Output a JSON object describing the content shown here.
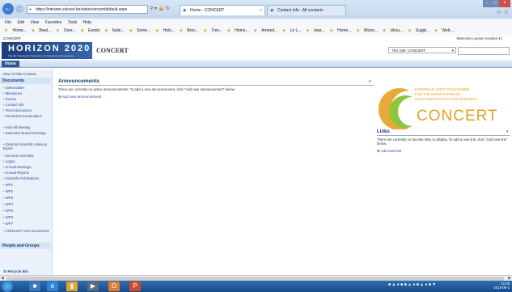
{
  "browser": {
    "address_url": "https://intranet.sckcen.be/sites/concert/default.aspx",
    "tabs": [
      {
        "label": "Home - CONCERT"
      },
      {
        "label": "Contact info - All contacts"
      }
    ],
    "menu": [
      "File",
      "Edit",
      "View",
      "Favorites",
      "Tools",
      "Help"
    ],
    "favorites": [
      "Home...",
      "Bowl...",
      "Over...",
      "Eendo",
      "Italie...",
      "Some...",
      "Hoki...",
      "Broc...",
      "Trev...",
      "Home...",
      "Ameed...",
      "Le L...",
      "step...",
      "Home...",
      "Wooo...",
      "zikou...",
      "Suggt...",
      "Web ..."
    ]
  },
  "sharepoint": {
    "breadcrumb": "CONCERT",
    "welcome": "Welcome Leysen Kristina ▾ |",
    "logo_text": "HORIZON 2020",
    "logo_sub": "The EU Framework Programme for Research and Innovation",
    "site_title": "CONCERT",
    "search_scope": "This Site: CONCERT",
    "home_tab": "Home",
    "view_all": "View All Site Content",
    "documents_heading": "Documents",
    "nav_items": [
      "Deliverables",
      "Milestones",
      "Events",
      "Contact info",
      "Team Discussion",
      "General Documentation",
      "Kick-off Meeting",
      "Executive Board Meetings",
      "External Scientific Advisory Board",
      "General Assembly",
      "Logos",
      "Annual Meetings",
      "Annual Reports",
      "Scientific Publications",
      "WP1",
      "WP2",
      "WP3",
      "WP4",
      "WP5",
      "WP6",
      "WP7",
      "CONCERT SCK Documents"
    ],
    "people_heading": "People and Groups",
    "recycle_bin": "Recycle Bin",
    "announcements": {
      "title": "Announcements",
      "empty": "There are currently no active announcements. To add a new announcement, click \"Add new announcement\" below.",
      "add": "Add new announcement"
    },
    "concert_logo": {
      "line1": "EUROPEAN JOINT PROGRAMME",
      "line2": "FOR THE INTEGRATION OF",
      "line3": "RADIATION PROTECTION RESEARCH",
      "name": "CONCERT"
    },
    "links": {
      "title": "Links",
      "empty": "There are currently no favorite links to display. To add a new link, click \"Add new link\" below.",
      "add": "Add new link"
    }
  },
  "taskbar": {
    "time": "12:46",
    "date": "2015-06-1"
  },
  "colors": {
    "accent": "#2b5796",
    "logo_orange": "#e5a023",
    "logo_green": "#8cc63f"
  }
}
